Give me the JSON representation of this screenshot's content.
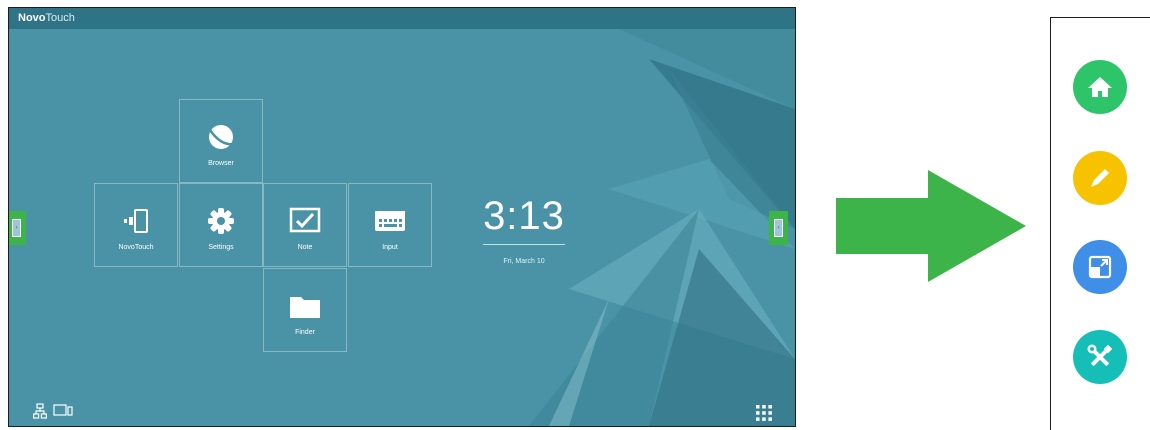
{
  "app": {
    "brand_bold": "Novo",
    "brand_light": "Touch"
  },
  "apps": [
    {
      "name": "browser",
      "label": "Browser",
      "icon": "browser-globe-icon"
    },
    {
      "name": "novotouch",
      "label": "NovoTouch",
      "icon": "novotouch-icon"
    },
    {
      "name": "settings",
      "label": "Settings",
      "icon": "gear-icon"
    },
    {
      "name": "note",
      "label": "Note",
      "icon": "note-icon"
    },
    {
      "name": "input",
      "label": "Input",
      "icon": "keyboard-icon"
    },
    {
      "name": "finder",
      "label": "Finder",
      "icon": "folder-icon"
    }
  ],
  "clock": {
    "time": "3:13",
    "date": "Fri, March 10"
  },
  "sidebar": [
    {
      "name": "home",
      "icon": "home-icon",
      "color": "#2ec56a"
    },
    {
      "name": "annotate",
      "icon": "pencil-icon",
      "color": "#f7c300"
    },
    {
      "name": "window",
      "icon": "window-expand-icon",
      "color": "#3f8ee8"
    },
    {
      "name": "tools",
      "icon": "tools-icon",
      "color": "#15bfb7"
    }
  ],
  "colors": {
    "accent_green": "#3cb449",
    "screen_bg": "#4a93a6"
  }
}
